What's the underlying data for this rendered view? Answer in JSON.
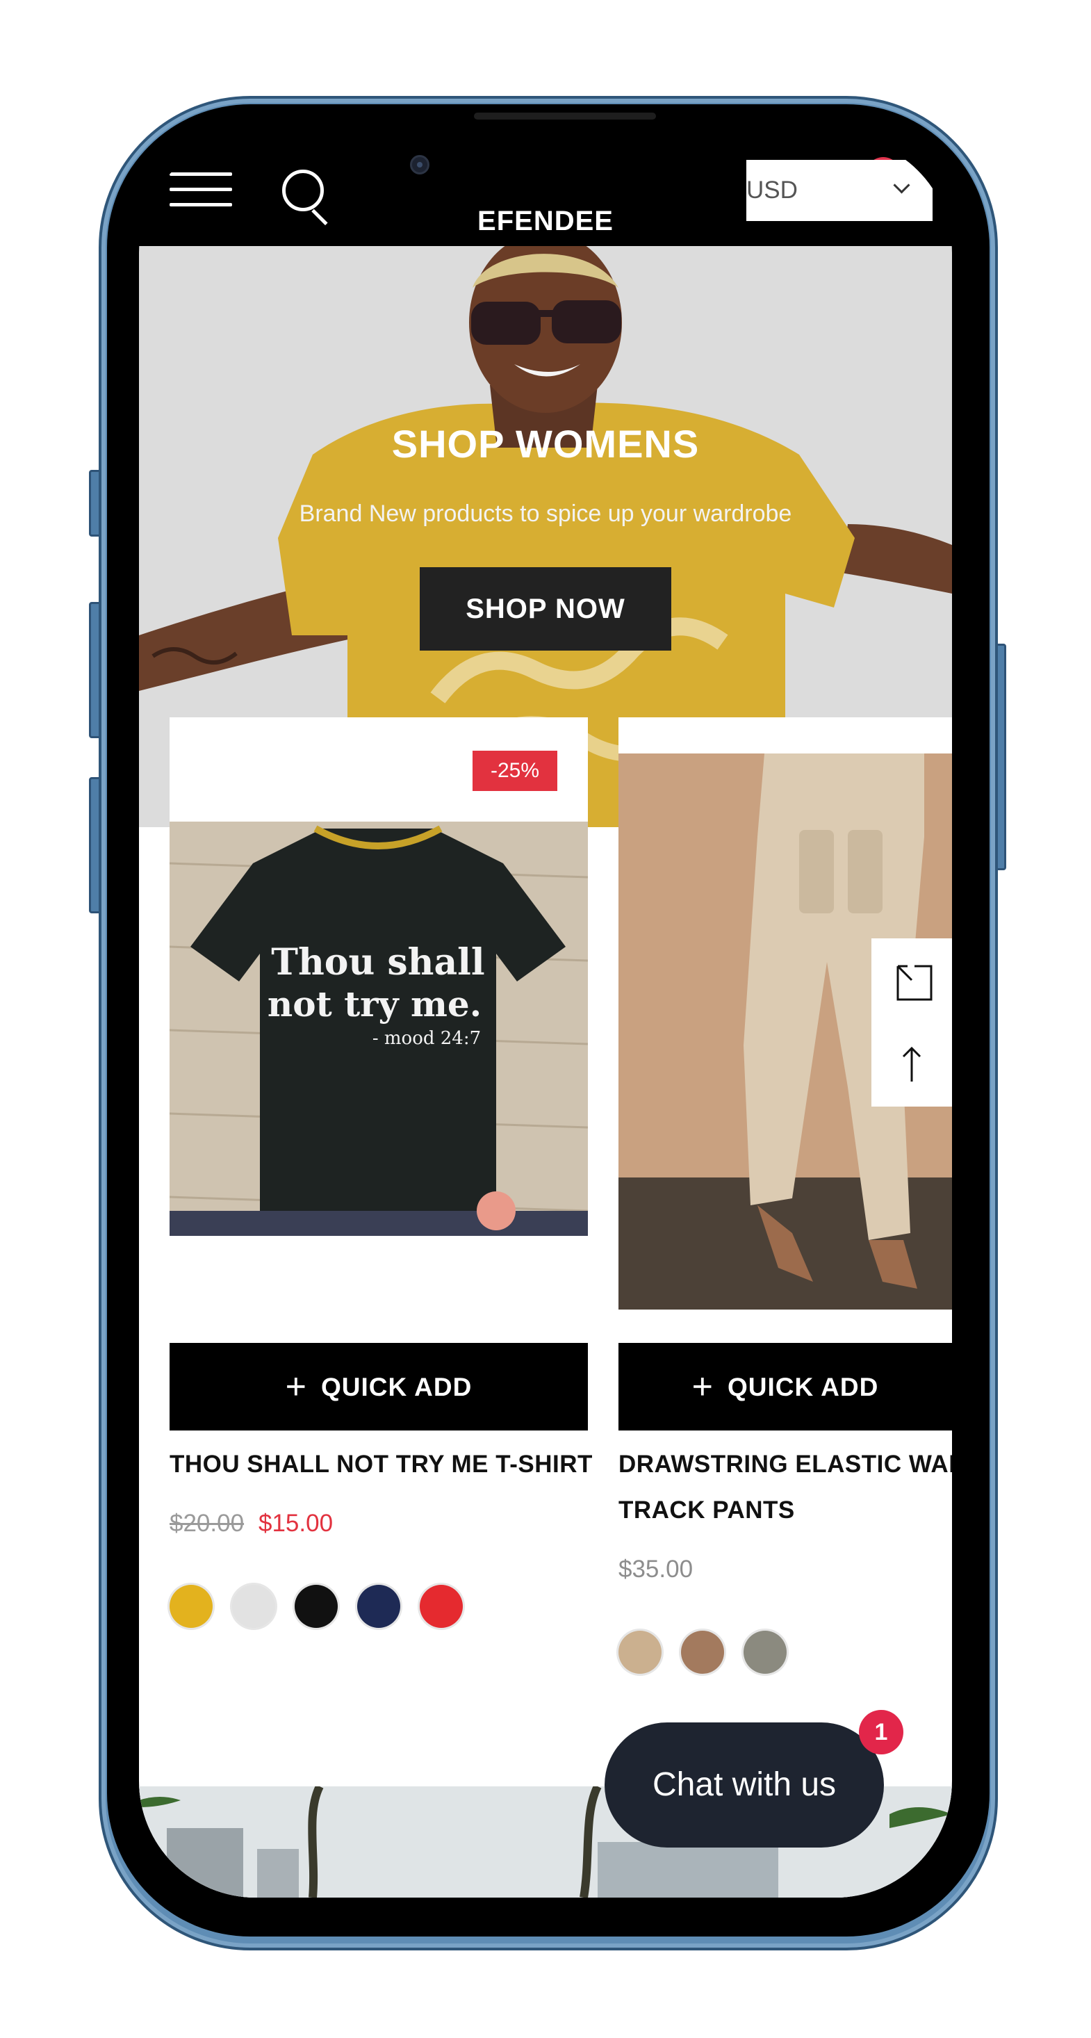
{
  "header": {
    "logo": "EFENDEE",
    "currency": {
      "selected": "USD"
    }
  },
  "hero": {
    "title": "SHOP WOMENS",
    "subtitle": "Brand New products to spice up your wardrobe",
    "button_label": "SHOP NOW"
  },
  "products": [
    {
      "badge": "-25%",
      "quick_add_label": "QUICK ADD",
      "name": "THOU SHALL NOT TRY ME T-SHIRT",
      "price_old": "$20.00",
      "price_new": "$15.00",
      "image_text_line1": "Thou shall",
      "image_text_line2": "not try me.",
      "image_text_line3": "- mood 24:7",
      "swatches": [
        "#e3b21e",
        "#e2e2e2",
        "#111111",
        "#1e2a55",
        "#e52a2f"
      ]
    },
    {
      "quick_add_label": "QUICK ADD",
      "name_line1": "DRAWSTRING ELASTIC WAIST",
      "name_line2": "TRACK PANTS",
      "price": "$35.00",
      "swatches": [
        "#cbb08f",
        "#a37a5e",
        "#8b8a7f"
      ]
    }
  ],
  "chat": {
    "label": "Chat with us",
    "unread_count": "1"
  },
  "colors": {
    "accent_red": "#e2323f",
    "button_dark": "#000000",
    "chat_bg": "#1e2430",
    "phone_frame": "#5f8db5"
  }
}
